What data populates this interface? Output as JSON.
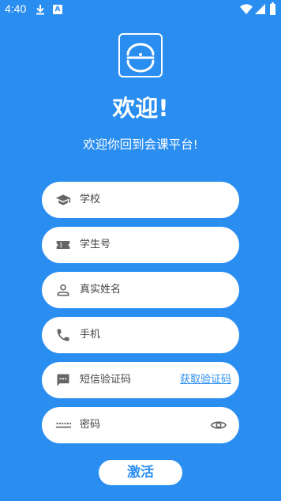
{
  "status": {
    "time": "4:40",
    "notif_letter": "A"
  },
  "title": "欢迎!",
  "subtitle": "欢迎你回到会课平台!",
  "fields": [
    {
      "placeholder": "学校",
      "icon": "graduation-cap-icon"
    },
    {
      "placeholder": "学生号",
      "icon": "ticket-icon"
    },
    {
      "placeholder": "真实姓名",
      "icon": "person-icon"
    },
    {
      "placeholder": "手机",
      "icon": "phone-icon"
    },
    {
      "placeholder": "短信验证码",
      "icon": "sms-icon",
      "action": "获取验证码"
    },
    {
      "placeholder": "密码",
      "icon": "password-icon",
      "trailing_icon": "eye-icon"
    }
  ],
  "activate_label": "激活",
  "colors": {
    "background": "#2a8ef0",
    "field": "#ffffff",
    "icon": "#666666"
  }
}
